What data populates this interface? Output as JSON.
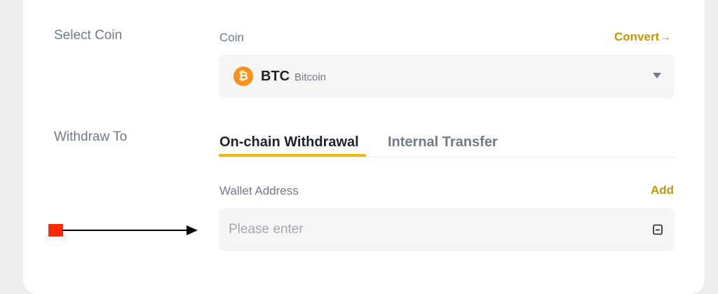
{
  "select_coin": {
    "section_label": "Select Coin",
    "field_label": "Coin",
    "convert_link": "Convert→",
    "selected": {
      "symbol": "BTC",
      "name": "Bitcoin",
      "icon": "bitcoin-icon",
      "icon_glyph": "₿",
      "icon_color": "#f7931a"
    }
  },
  "withdraw_to": {
    "section_label": "Withdraw To",
    "tabs": [
      {
        "label": "On-chain Withdrawal",
        "active": true
      },
      {
        "label": "Internal Transfer",
        "active": false
      }
    ],
    "wallet_address": {
      "label": "Wallet Address",
      "add_link": "Add",
      "value": "",
      "placeholder": "Please enter",
      "icon": "address-book-icon"
    }
  },
  "annotation": {
    "marker_color": "#ff2a00",
    "arrow": "arrow-right-icon"
  },
  "colors": {
    "accent": "#c99400",
    "tab_underline": "#f0b90b",
    "text_primary": "#1e2329",
    "text_secondary": "#707a8a",
    "input_bg": "#f5f5f5"
  }
}
